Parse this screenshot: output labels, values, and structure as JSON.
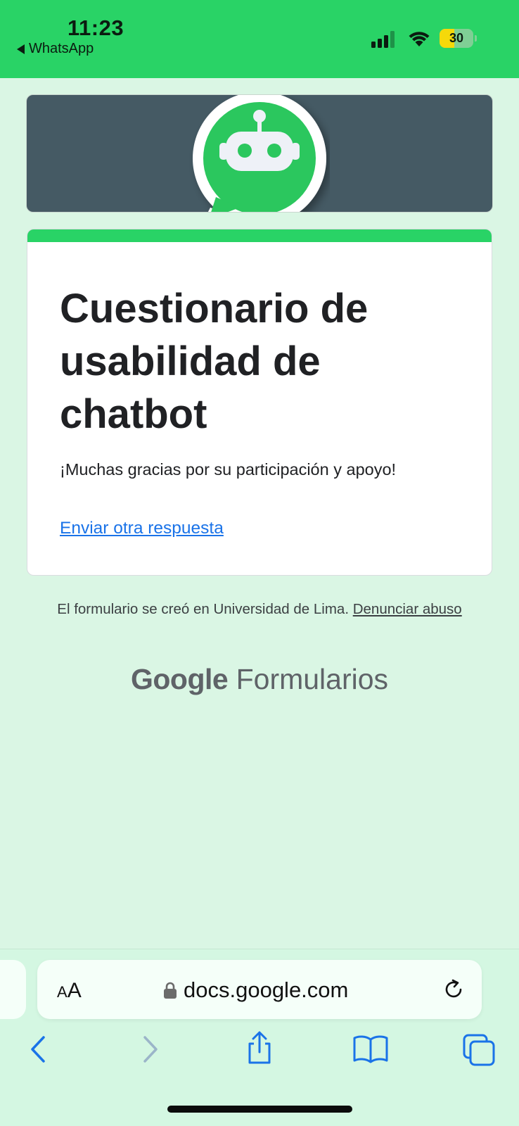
{
  "status_bar": {
    "time": "11:23",
    "back_app": "WhatsApp",
    "battery_percent": "30",
    "background_color": "#29d366"
  },
  "banner": {
    "logo_icon": "whatsapp-robot-logo-icon",
    "background_color": "#455a64"
  },
  "form": {
    "title": "Cuestionario de usabilidad de chatbot",
    "message": "¡Muchas gracias por su participación y apoyo!",
    "resubmit_link": "Enviar otra respuesta",
    "accent_color": "#29d366"
  },
  "footer": {
    "created_note": "El formulario se creó en Universidad de Lima.",
    "report_link": "Denunciar abuso",
    "brand_google": "Google",
    "brand_product": "Formularios"
  },
  "browser": {
    "text_size_label_small": "A",
    "text_size_label_large": "A",
    "url": "docs.google.com",
    "toolbar_icons": [
      "back-arrow-icon",
      "forward-arrow-icon",
      "share-icon",
      "bookmarks-icon",
      "tabs-icon"
    ]
  }
}
